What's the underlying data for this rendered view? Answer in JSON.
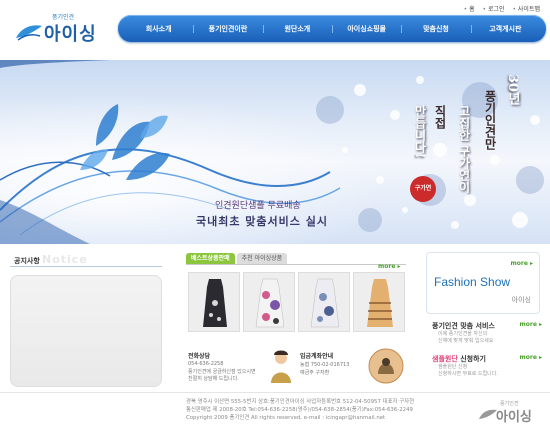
{
  "header": {
    "logo_sub": "풍기인견",
    "logo_main": "아이싱",
    "utility_links": [
      "홈",
      "로그인",
      "사이트맵"
    ]
  },
  "nav": {
    "items": [
      "회사소개",
      "풍기인견이란",
      "원단소개",
      "아이싱쇼핑몰",
      "맞춤신청",
      "고객게시판"
    ]
  },
  "hero": {
    "promo_line1": "인견원단샘플 무료배송",
    "promo_line2": "국내최초 맞춤서비스 실시",
    "vertical_lines": [
      "30년",
      "풍기인견만",
      "고집한 구가연이",
      "직접",
      "만듭니다!"
    ],
    "badge": "구가연",
    "colors": {
      "sky": "#c7d9f2",
      "accent": "#1f5fa8"
    }
  },
  "notice": {
    "title": "공지사항",
    "watermark": "Notice"
  },
  "products": {
    "tabs": [
      "베스트상품판매",
      "추천 아이싱상품"
    ],
    "more": "more",
    "items": [
      {
        "name": "product-1",
        "color": "#2a2a30"
      },
      {
        "name": "product-2",
        "color": "#d25a8c"
      },
      {
        "name": "product-3",
        "color": "#7a8fb8"
      },
      {
        "name": "product-4",
        "color": "#c98a50"
      }
    ]
  },
  "contact": {
    "phone_title": "전화상담",
    "phone_lines": [
      "054-636-2258",
      "풍기인견에 궁금하신점 있으시면",
      "친절히 상담해 드립니다."
    ],
    "account_title": "입금계좌안내",
    "account_lines": [
      "농협 750-02-016713",
      "예금주 구자환"
    ]
  },
  "right": {
    "fashion_more": "more",
    "fashion_title": "Fashion Show",
    "fashion_logo": "아이싱",
    "service1_title_hl": "",
    "service1_title": "풍기인견 맞춤 서비스",
    "service1_more": "more",
    "service1_desc": [
      "이제 풍기인견을 자신의",
      "신체에 맞게 맞춰 입으세요"
    ],
    "service2_title_hl": "샘플원단",
    "service2_title": " 신청하기",
    "service2_more": "more",
    "service2_desc": [
      "샘플원단 신청",
      "신청하시면 무료로 드립니다."
    ]
  },
  "footer": {
    "lines": [
      "경북 영주시 이산면 555-5번지 상호:풍기인견아이싱 사업자등록번호 512-04-50957 대표자 구자현",
      "통신판매업 제 2008-20호 Tel:054-636-2258(영주)/054-638-2854(풍기)Fax:054-636-2249",
      "Copyright 2009 풍기인견 All rights reserved, e-mail : icingapr@hanmail.net"
    ],
    "logo_sub": "풍기인견",
    "logo_main": "아이싱"
  }
}
